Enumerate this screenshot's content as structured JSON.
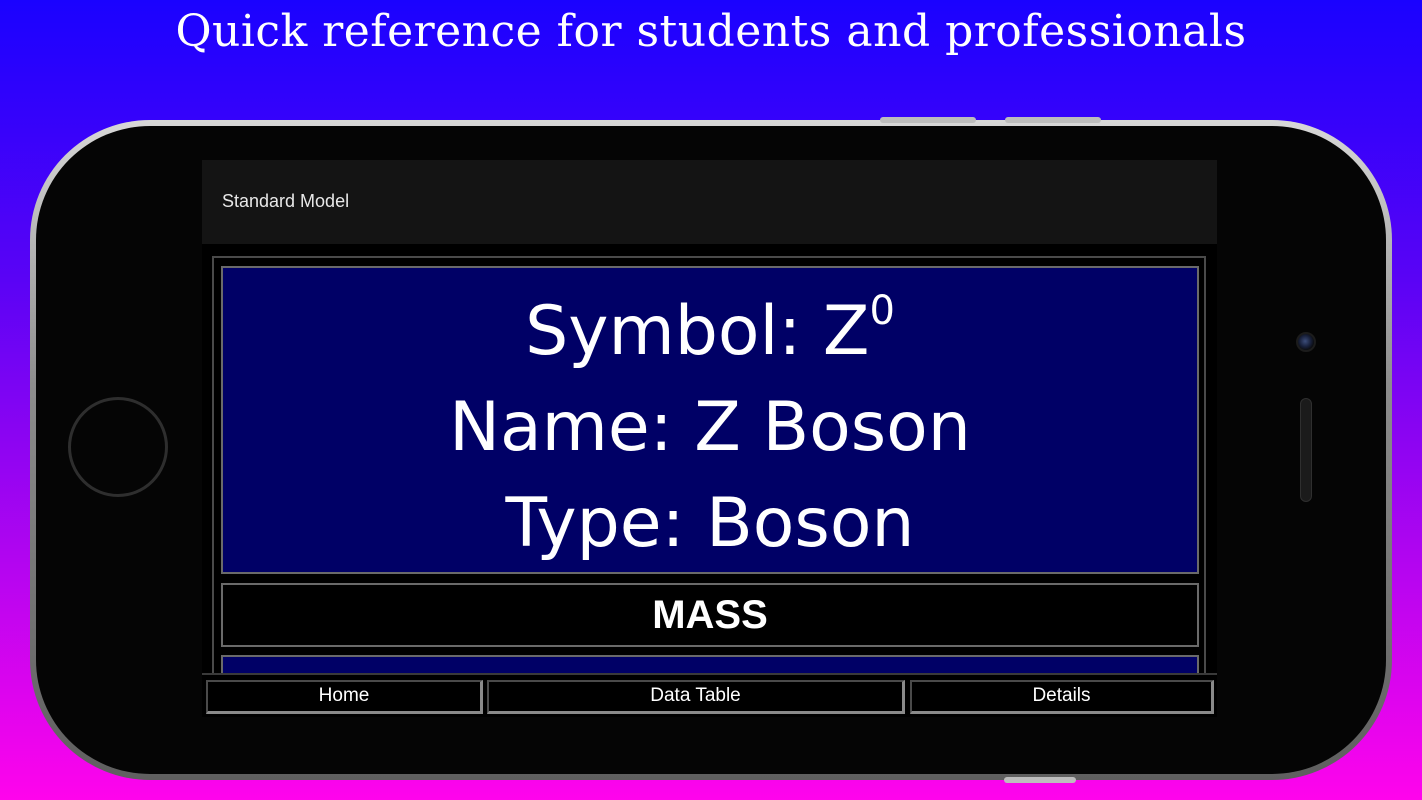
{
  "promo": {
    "headline": "Quick reference for students and professionals"
  },
  "app": {
    "title": "Standard Model"
  },
  "particle": {
    "symbol_label": "Symbol: Z",
    "symbol_superscript": "0",
    "name_line": "Name: Z Boson",
    "type_line": "Type: Boson"
  },
  "section": {
    "mass_header": "MASS"
  },
  "nav": {
    "items": [
      {
        "label": "Home"
      },
      {
        "label": "Data Table"
      },
      {
        "label": "Details"
      }
    ]
  },
  "colors": {
    "card_background": "#000066",
    "appbar_background": "#141414",
    "gradient_top": "#1a02ff",
    "gradient_bottom": "#ff04ec"
  }
}
